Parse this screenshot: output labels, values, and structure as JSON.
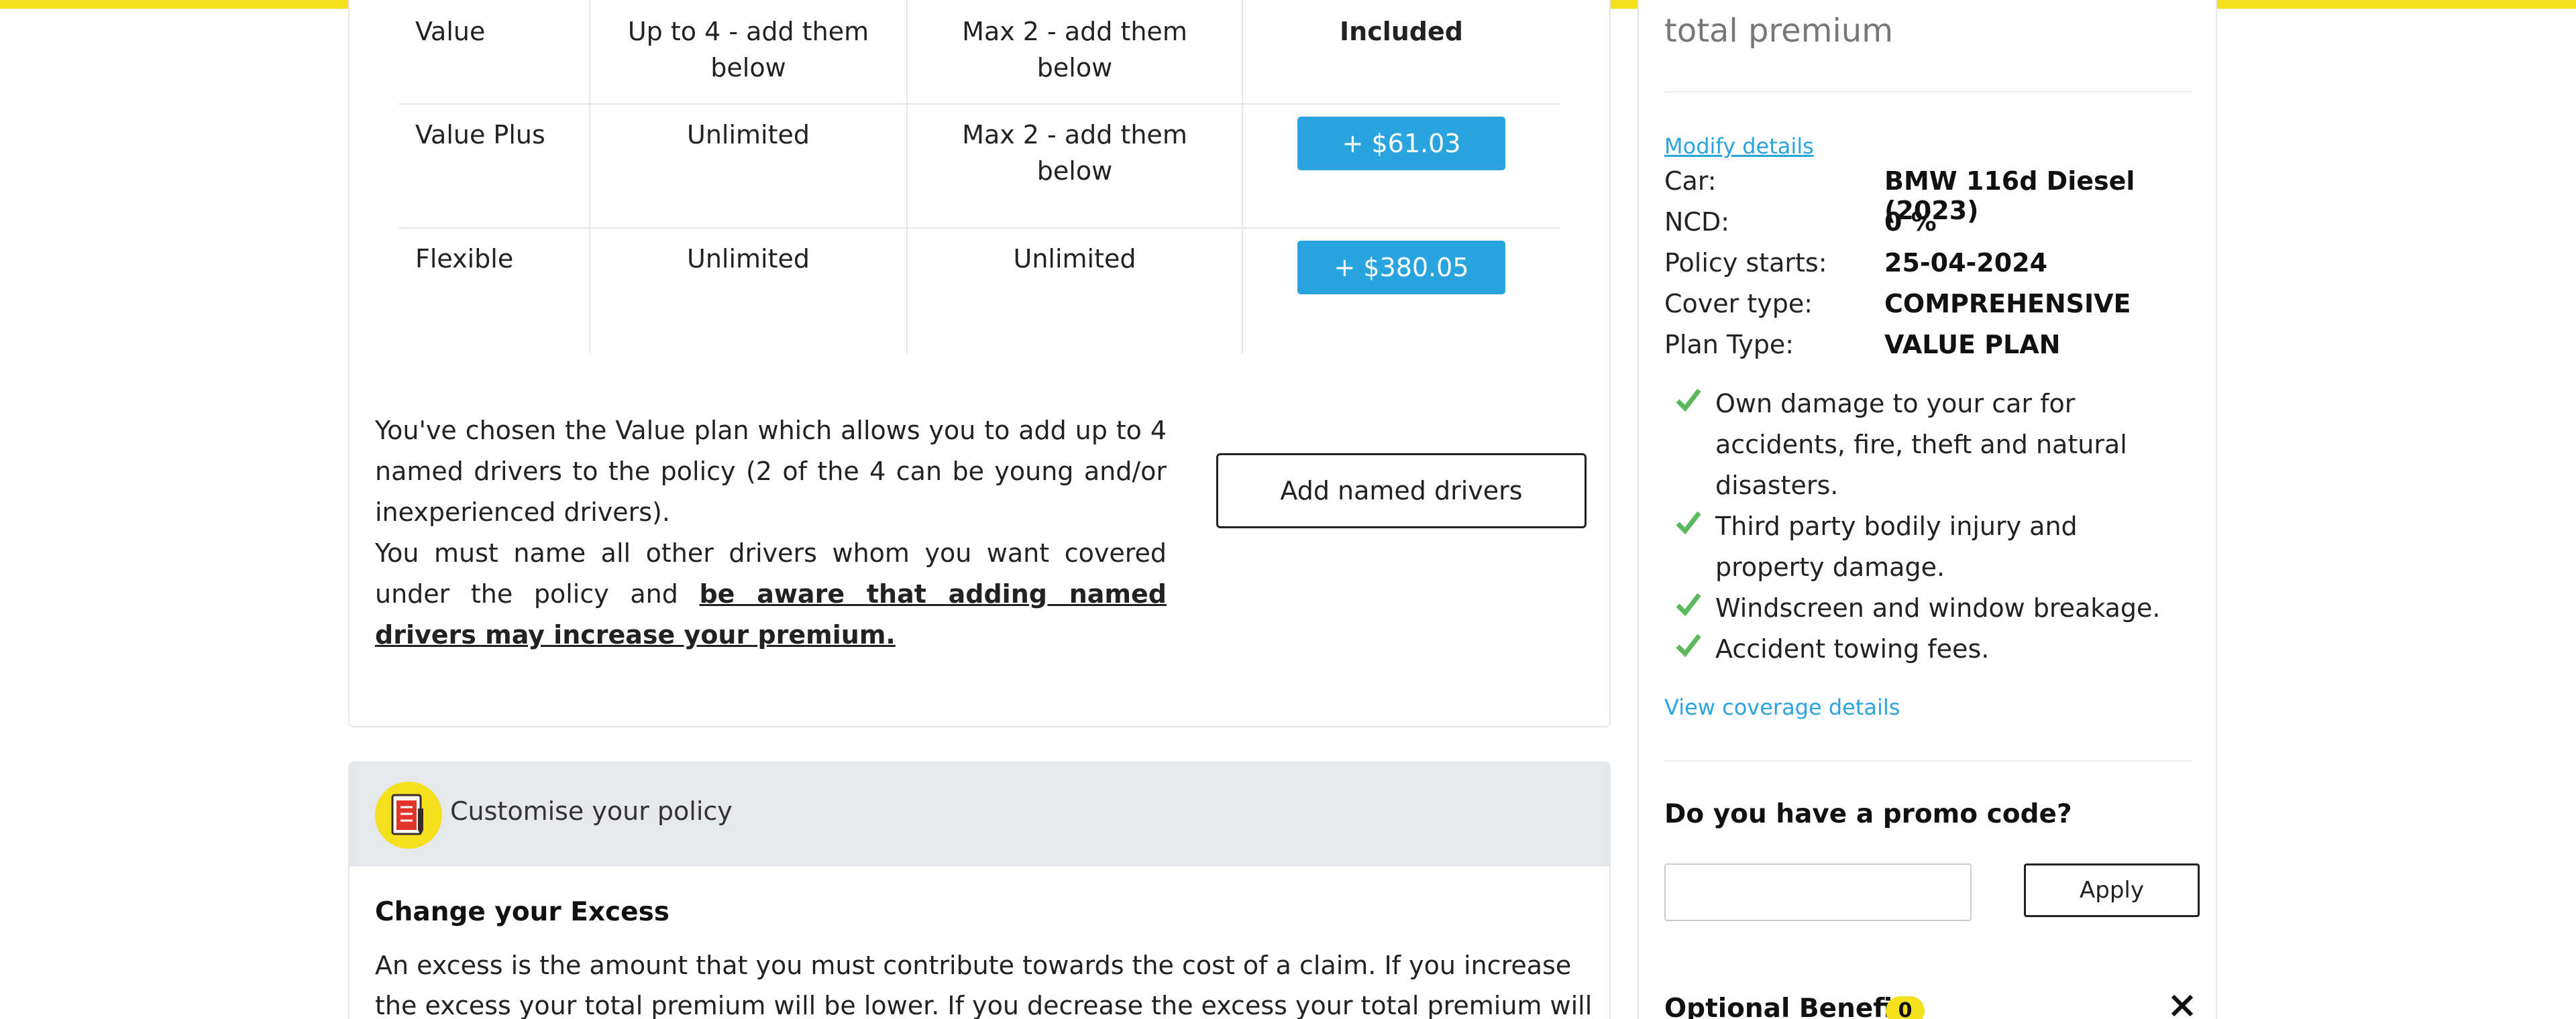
{
  "plans": [
    {
      "name": "Value",
      "named_drivers": "Up to 4 - add them below",
      "young_drivers": "Max 2 - add them below",
      "price": "Included",
      "is_included": true
    },
    {
      "name": "Value Plus",
      "named_drivers": "Unlimited",
      "young_drivers": "Max 2 - add them below",
      "price": "+ $61.03",
      "is_included": false
    },
    {
      "name": "Flexible",
      "named_drivers": "Unlimited",
      "young_drivers": "Unlimited",
      "price": "+ $380.05",
      "is_included": false
    }
  ],
  "explain": {
    "text1": "You've chosen the Value plan which allows you to add up to 4 named drivers to the policy (2 of the 4 can be young and/or inexperienced drivers).",
    "text2": "You must name all other drivers whom you want covered under the policy and ",
    "text2_link": "be aware that adding named drivers may increase your premium."
  },
  "add_drivers_label": "Add named drivers",
  "customise": {
    "title": "Customise your policy",
    "icon": "policy-document-icon",
    "excess_title": "Change your Excess",
    "excess_text": "An excess is the amount that you must contribute towards the cost of a claim. If you increase the excess your total premium will be lower. If you decrease the excess your total premium will"
  },
  "sidebar": {
    "total_premium_label": "total premium",
    "modify_label": "Modify details",
    "details": [
      {
        "key": "Car:",
        "value": "BMW 116d Diesel (2023)"
      },
      {
        "key": "NCD:",
        "value": "0 %"
      },
      {
        "key": "Policy starts:",
        "value": "25-04-2024"
      },
      {
        "key": "Cover type:",
        "value": "COMPREHENSIVE"
      },
      {
        "key": "Plan Type:",
        "value": "VALUE PLAN"
      }
    ],
    "coverage": [
      "Own damage to your car for accidents, fire, theft and natural disasters.",
      "Third party bodily injury and property damage.",
      "Windscreen and window breakage.",
      "Accident towing fees."
    ],
    "view_coverage_label": "View coverage details",
    "promo_title": "Do you have a promo code?",
    "promo_value": "",
    "apply_label": "Apply",
    "optional_benefits_label": "Optional Benefits",
    "optional_benefits_count": "0"
  },
  "colors": {
    "accent_yellow": "#f5e11b",
    "button_blue": "#2aa4de",
    "check_green": "#5cb85c"
  }
}
